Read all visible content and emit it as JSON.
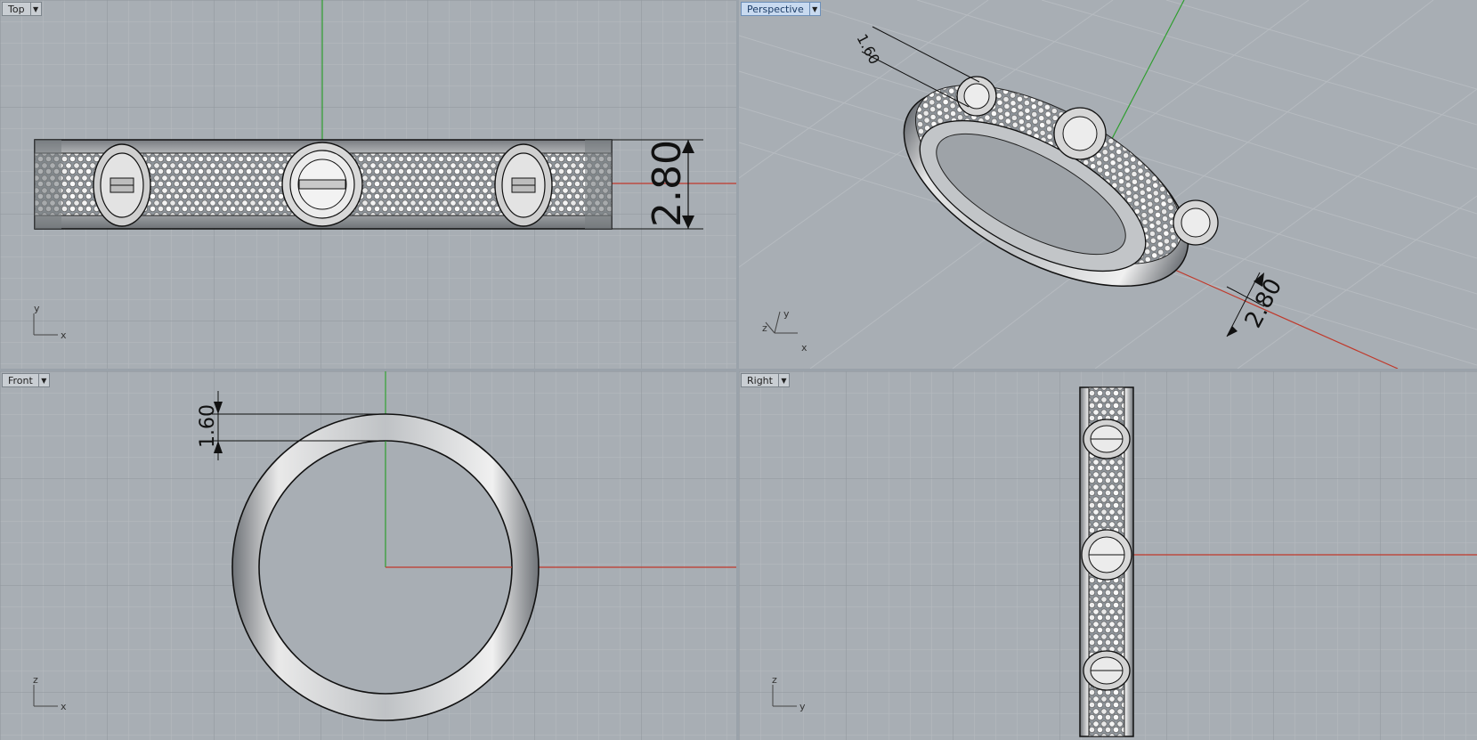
{
  "colors": {
    "background": "#a8aeb4",
    "grid_minor": "#b4babf",
    "grid_major": "#8e959c",
    "x_axis": "#c0392b",
    "y_axis": "#2f9e2f",
    "active_tab": "#c8daf0"
  },
  "viewports": [
    {
      "label": "Top",
      "dimension": "2.80",
      "axis_h": "x",
      "axis_v": "y",
      "active": false
    },
    {
      "label": "Perspective",
      "dimension_a": "1.60",
      "dimension_b": "2.80",
      "axis_h": "x",
      "axis_v": "y",
      "axis_z": "z",
      "active": true
    },
    {
      "label": "Front",
      "dimension": "1.60",
      "axis_h": "x",
      "axis_v": "z",
      "active": false
    },
    {
      "label": "Right",
      "axis_h": "y",
      "axis_v": "z",
      "active": false
    }
  ],
  "icons": {
    "dropdown": "chevron-down-icon"
  }
}
